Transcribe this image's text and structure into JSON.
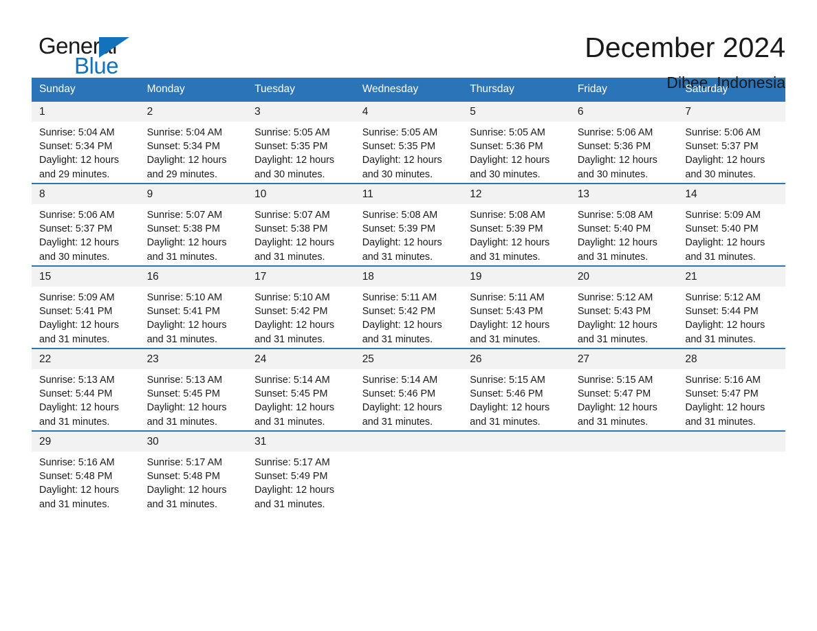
{
  "logo": {
    "word_one": "General",
    "word_two": "Blue",
    "triangle_icon": "triangle-icon",
    "brand_color": "#1272bc"
  },
  "header": {
    "title": "December 2024",
    "location": "Dibee, Indonesia"
  },
  "theme": {
    "header_blue": "#2b74b8",
    "daynum_band": "#f2f2f2",
    "text": "#1a1a1a"
  },
  "calendar": {
    "weekday_headers": [
      "Sunday",
      "Monday",
      "Tuesday",
      "Wednesday",
      "Thursday",
      "Friday",
      "Saturday"
    ],
    "labels": {
      "sunrise": "Sunrise:",
      "sunset": "Sunset:",
      "daylight": "Daylight:"
    },
    "weeks": [
      [
        {
          "day": "1",
          "sunrise": "Sunrise: 5:04 AM",
          "sunset": "Sunset: 5:34 PM",
          "daylight": "Daylight: 12 hours and 29 minutes."
        },
        {
          "day": "2",
          "sunrise": "Sunrise: 5:04 AM",
          "sunset": "Sunset: 5:34 PM",
          "daylight": "Daylight: 12 hours and 29 minutes."
        },
        {
          "day": "3",
          "sunrise": "Sunrise: 5:05 AM",
          "sunset": "Sunset: 5:35 PM",
          "daylight": "Daylight: 12 hours and 30 minutes."
        },
        {
          "day": "4",
          "sunrise": "Sunrise: 5:05 AM",
          "sunset": "Sunset: 5:35 PM",
          "daylight": "Daylight: 12 hours and 30 minutes."
        },
        {
          "day": "5",
          "sunrise": "Sunrise: 5:05 AM",
          "sunset": "Sunset: 5:36 PM",
          "daylight": "Daylight: 12 hours and 30 minutes."
        },
        {
          "day": "6",
          "sunrise": "Sunrise: 5:06 AM",
          "sunset": "Sunset: 5:36 PM",
          "daylight": "Daylight: 12 hours and 30 minutes."
        },
        {
          "day": "7",
          "sunrise": "Sunrise: 5:06 AM",
          "sunset": "Sunset: 5:37 PM",
          "daylight": "Daylight: 12 hours and 30 minutes."
        }
      ],
      [
        {
          "day": "8",
          "sunrise": "Sunrise: 5:06 AM",
          "sunset": "Sunset: 5:37 PM",
          "daylight": "Daylight: 12 hours and 30 minutes."
        },
        {
          "day": "9",
          "sunrise": "Sunrise: 5:07 AM",
          "sunset": "Sunset: 5:38 PM",
          "daylight": "Daylight: 12 hours and 31 minutes."
        },
        {
          "day": "10",
          "sunrise": "Sunrise: 5:07 AM",
          "sunset": "Sunset: 5:38 PM",
          "daylight": "Daylight: 12 hours and 31 minutes."
        },
        {
          "day": "11",
          "sunrise": "Sunrise: 5:08 AM",
          "sunset": "Sunset: 5:39 PM",
          "daylight": "Daylight: 12 hours and 31 minutes."
        },
        {
          "day": "12",
          "sunrise": "Sunrise: 5:08 AM",
          "sunset": "Sunset: 5:39 PM",
          "daylight": "Daylight: 12 hours and 31 minutes."
        },
        {
          "day": "13",
          "sunrise": "Sunrise: 5:08 AM",
          "sunset": "Sunset: 5:40 PM",
          "daylight": "Daylight: 12 hours and 31 minutes."
        },
        {
          "day": "14",
          "sunrise": "Sunrise: 5:09 AM",
          "sunset": "Sunset: 5:40 PM",
          "daylight": "Daylight: 12 hours and 31 minutes."
        }
      ],
      [
        {
          "day": "15",
          "sunrise": "Sunrise: 5:09 AM",
          "sunset": "Sunset: 5:41 PM",
          "daylight": "Daylight: 12 hours and 31 minutes."
        },
        {
          "day": "16",
          "sunrise": "Sunrise: 5:10 AM",
          "sunset": "Sunset: 5:41 PM",
          "daylight": "Daylight: 12 hours and 31 minutes."
        },
        {
          "day": "17",
          "sunrise": "Sunrise: 5:10 AM",
          "sunset": "Sunset: 5:42 PM",
          "daylight": "Daylight: 12 hours and 31 minutes."
        },
        {
          "day": "18",
          "sunrise": "Sunrise: 5:11 AM",
          "sunset": "Sunset: 5:42 PM",
          "daylight": "Daylight: 12 hours and 31 minutes."
        },
        {
          "day": "19",
          "sunrise": "Sunrise: 5:11 AM",
          "sunset": "Sunset: 5:43 PM",
          "daylight": "Daylight: 12 hours and 31 minutes."
        },
        {
          "day": "20",
          "sunrise": "Sunrise: 5:12 AM",
          "sunset": "Sunset: 5:43 PM",
          "daylight": "Daylight: 12 hours and 31 minutes."
        },
        {
          "day": "21",
          "sunrise": "Sunrise: 5:12 AM",
          "sunset": "Sunset: 5:44 PM",
          "daylight": "Daylight: 12 hours and 31 minutes."
        }
      ],
      [
        {
          "day": "22",
          "sunrise": "Sunrise: 5:13 AM",
          "sunset": "Sunset: 5:44 PM",
          "daylight": "Daylight: 12 hours and 31 minutes."
        },
        {
          "day": "23",
          "sunrise": "Sunrise: 5:13 AM",
          "sunset": "Sunset: 5:45 PM",
          "daylight": "Daylight: 12 hours and 31 minutes."
        },
        {
          "day": "24",
          "sunrise": "Sunrise: 5:14 AM",
          "sunset": "Sunset: 5:45 PM",
          "daylight": "Daylight: 12 hours and 31 minutes."
        },
        {
          "day": "25",
          "sunrise": "Sunrise: 5:14 AM",
          "sunset": "Sunset: 5:46 PM",
          "daylight": "Daylight: 12 hours and 31 minutes."
        },
        {
          "day": "26",
          "sunrise": "Sunrise: 5:15 AM",
          "sunset": "Sunset: 5:46 PM",
          "daylight": "Daylight: 12 hours and 31 minutes."
        },
        {
          "day": "27",
          "sunrise": "Sunrise: 5:15 AM",
          "sunset": "Sunset: 5:47 PM",
          "daylight": "Daylight: 12 hours and 31 minutes."
        },
        {
          "day": "28",
          "sunrise": "Sunrise: 5:16 AM",
          "sunset": "Sunset: 5:47 PM",
          "daylight": "Daylight: 12 hours and 31 minutes."
        }
      ],
      [
        {
          "day": "29",
          "sunrise": "Sunrise: 5:16 AM",
          "sunset": "Sunset: 5:48 PM",
          "daylight": "Daylight: 12 hours and 31 minutes."
        },
        {
          "day": "30",
          "sunrise": "Sunrise: 5:17 AM",
          "sunset": "Sunset: 5:48 PM",
          "daylight": "Daylight: 12 hours and 31 minutes."
        },
        {
          "day": "31",
          "sunrise": "Sunrise: 5:17 AM",
          "sunset": "Sunset: 5:49 PM",
          "daylight": "Daylight: 12 hours and 31 minutes."
        },
        {
          "day": "",
          "sunrise": "",
          "sunset": "",
          "daylight": ""
        },
        {
          "day": "",
          "sunrise": "",
          "sunset": "",
          "daylight": ""
        },
        {
          "day": "",
          "sunrise": "",
          "sunset": "",
          "daylight": ""
        },
        {
          "day": "",
          "sunrise": "",
          "sunset": "",
          "daylight": ""
        }
      ]
    ]
  }
}
